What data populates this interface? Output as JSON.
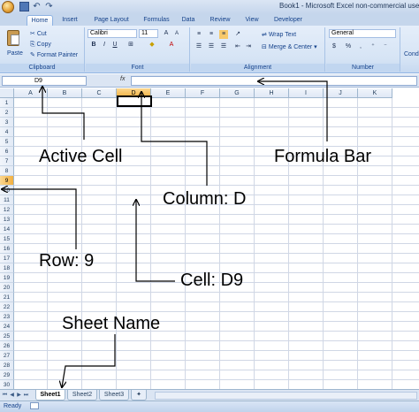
{
  "window": {
    "title": "Book1 - Microsoft Excel non-commercial use"
  },
  "ribbon": {
    "tabs": [
      "Home",
      "Insert",
      "Page Layout",
      "Formulas",
      "Data",
      "Review",
      "View",
      "Developer"
    ],
    "active_tab": "Home",
    "clipboard": {
      "paste": "Paste",
      "cut": "Cut",
      "copy": "Copy",
      "format_painter": "Format Painter",
      "label": "Clipboard"
    },
    "font": {
      "name": "Calibri",
      "size": "11",
      "label": "Font"
    },
    "alignment": {
      "wrap_text": "Wrap Text",
      "merge_center": "Merge & Center",
      "label": "Alignment"
    },
    "number": {
      "format": "General",
      "label": "Number"
    },
    "styles": {
      "conditional": "Cond"
    }
  },
  "formula_bar": {
    "name_box": "D9",
    "fx": "fx",
    "content": ""
  },
  "grid": {
    "columns": [
      "A",
      "B",
      "C",
      "D",
      "E",
      "F",
      "G",
      "H",
      "I",
      "J",
      "K"
    ],
    "rows": [
      "1",
      "2",
      "3",
      "4",
      "5",
      "6",
      "7",
      "8",
      "9",
      "10",
      "11",
      "12",
      "13",
      "14",
      "15",
      "16",
      "17",
      "18",
      "19",
      "20",
      "21",
      "22",
      "23",
      "24",
      "25",
      "26",
      "27",
      "28",
      "29",
      "30"
    ],
    "selected_column": "D",
    "selected_row": "9"
  },
  "annotations": {
    "active_cell": "Active Cell",
    "formula_bar": "Formula Bar",
    "column": "Column: D",
    "row": "Row: 9",
    "cell": "Cell: D9",
    "sheet_name": "Sheet Name"
  },
  "sheet_tabs": [
    "Sheet1",
    "Sheet2",
    "Sheet3"
  ],
  "active_sheet": "Sheet1",
  "status": "Ready",
  "colors": {
    "selected_header": "#f2b040",
    "ribbon_text": "#15428b"
  }
}
